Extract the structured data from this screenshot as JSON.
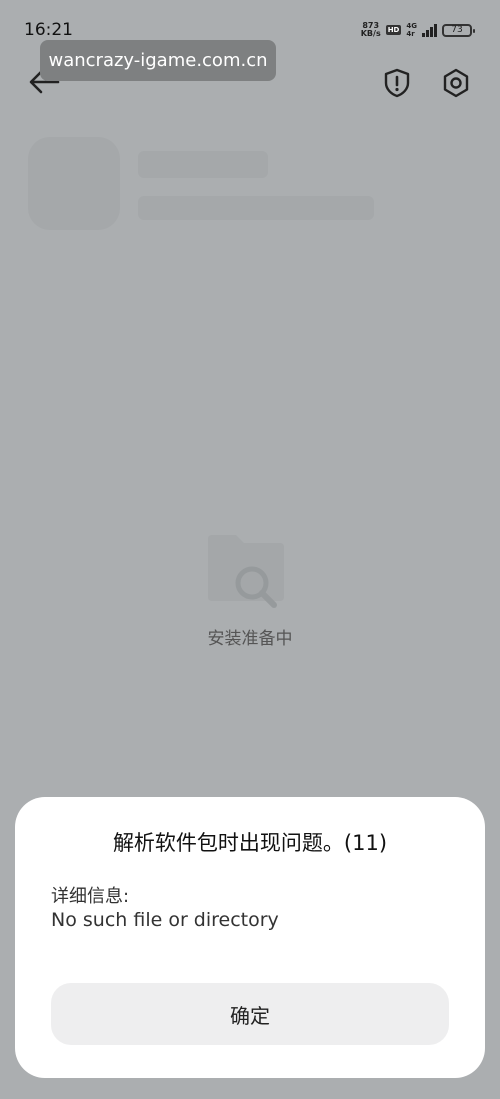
{
  "status_bar": {
    "time": "16:21",
    "net_speed_value": "873",
    "net_speed_unit": "KB/s",
    "hd_badge": "HD",
    "signal_gen_top": "4G",
    "signal_gen_bottom": "4r",
    "battery_level": "73"
  },
  "overlay": {
    "url": "wancrazy-igame.com.cn"
  },
  "installer": {
    "status_text": "安装准备中"
  },
  "dialog": {
    "title": "解析软件包时出现问题。(11)",
    "detail_label": "详细信息:",
    "detail_text": "No such file or directory",
    "confirm_label": "确定"
  },
  "icons": {
    "back": "back-arrow-icon",
    "shield": "shield-alert-icon",
    "settings": "gear-icon",
    "loading": "folder-search-icon"
  },
  "colors": {
    "background": "#abaeb0",
    "overlay_bg": "#7e8081",
    "dialog_bg": "#ffffff",
    "button_bg": "#eeeeef"
  }
}
